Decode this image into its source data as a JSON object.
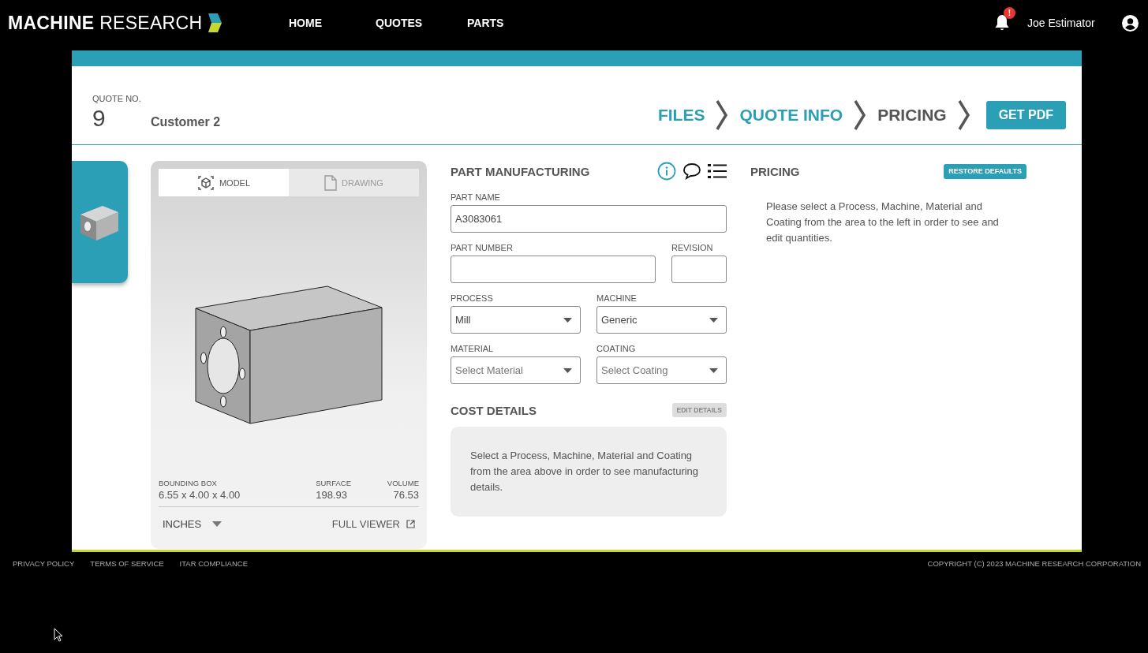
{
  "header": {
    "logo": {
      "bold": "MACHINE",
      "light": "RESEARCH"
    },
    "nav": [
      {
        "label": "HOME"
      },
      {
        "label": "QUOTES"
      },
      {
        "label": "PARTS"
      }
    ],
    "notification_badge": "!",
    "user_name": "Joe Estimator"
  },
  "quote": {
    "number_label": "QUOTE NO.",
    "number": "9",
    "customer": "Customer 2"
  },
  "steps": [
    {
      "label": "FILES",
      "reached": true
    },
    {
      "label": "QUOTE INFO",
      "reached": true
    },
    {
      "label": "PRICING",
      "reached": false
    }
  ],
  "pdf_button": "GET PDF",
  "viewer": {
    "tabs": [
      {
        "label": "MODEL",
        "selected": true
      },
      {
        "label": "DRAWING",
        "selected": false
      }
    ],
    "stats": [
      {
        "label": "BOUNDING BOX",
        "value": "6.55 x 4.00 x 4.00"
      },
      {
        "label": "SURFACE",
        "value": "198.93"
      },
      {
        "label": "VOLUME",
        "value": "76.53"
      }
    ],
    "units": "INCHES",
    "full_viewer": "FULL VIEWER"
  },
  "part_manufacturing": {
    "title": "PART MANUFACTURING",
    "rows": [
      [
        {
          "kind": "text",
          "label": "PART NAME",
          "value": "A3083061"
        }
      ],
      [
        {
          "kind": "text",
          "label": "PART NUMBER"
        },
        {
          "kind": "text",
          "label": "REVISION"
        }
      ],
      [
        {
          "kind": "select",
          "label": "PROCESS",
          "value": "Mill"
        },
        {
          "kind": "select",
          "label": "MACHINE",
          "value": "Generic"
        }
      ],
      [
        {
          "kind": "select",
          "label": "MATERIAL",
          "placeholder": "Select Material"
        },
        {
          "kind": "select",
          "label": "COATING",
          "placeholder": "Select Coating"
        }
      ]
    ]
  },
  "cost_details": {
    "title": "COST DETAILS",
    "button": "EDIT DETAILS",
    "message": "Select a Process, Machine, Material and Coating from the area above in order to see manufacturing details."
  },
  "pricing": {
    "title": "PRICING",
    "button": "RESTORE DEFAULTS",
    "message": "Please select a Process, Machine, Material and Coating from the area to the left in order to see and edit quantities."
  },
  "footer": {
    "links": [
      {
        "label": "PRIVACY POLICY"
      },
      {
        "label": "TERMS OF SERVICE"
      },
      {
        "label": "ITAR COMPLIANCE"
      }
    ],
    "copyright": "COPYRIGHT (C) 2023 MACHINE RESEARCH CORPORATION"
  }
}
